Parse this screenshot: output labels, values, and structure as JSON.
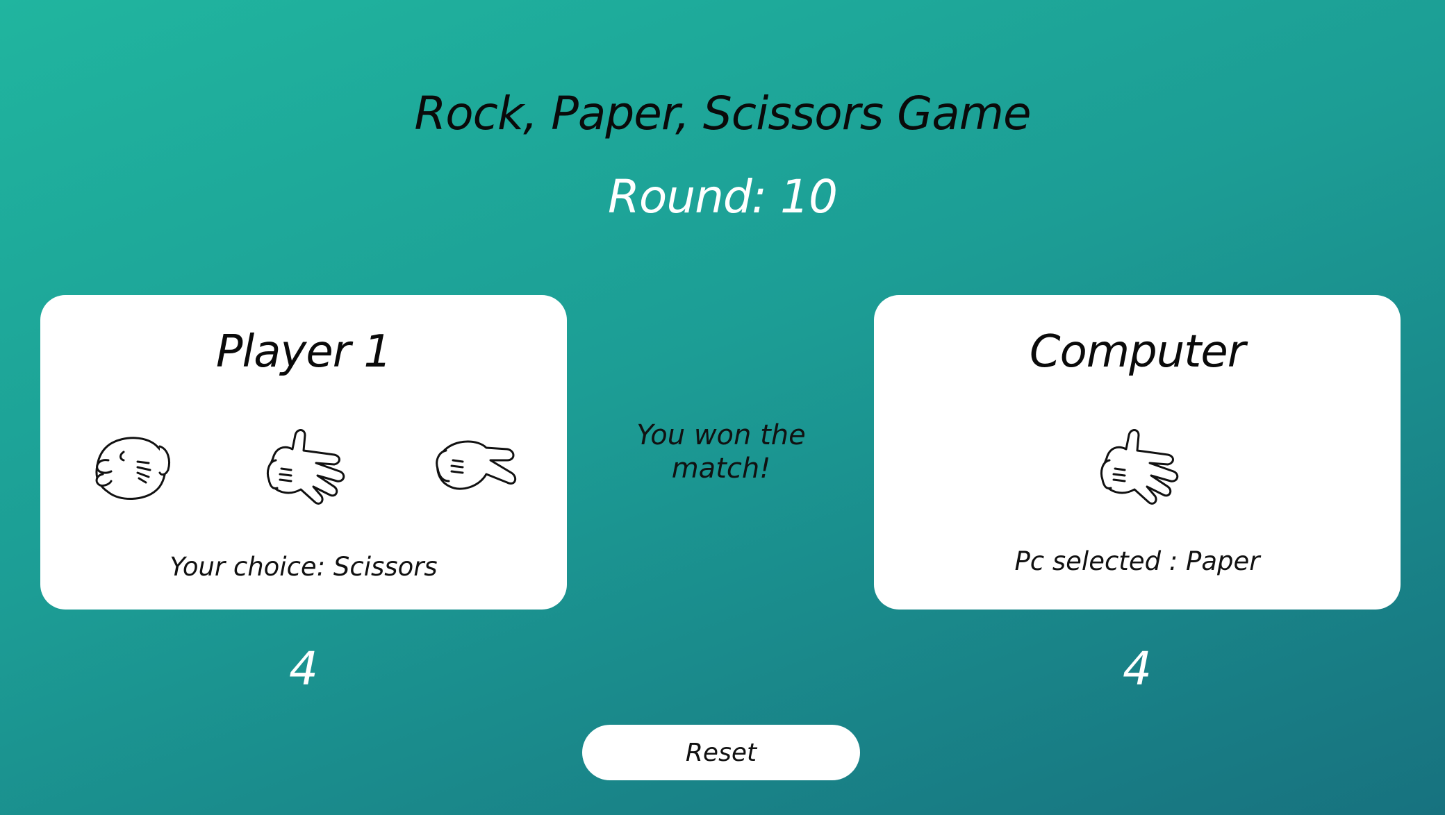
{
  "header": {
    "title": "Rock, Paper, Scissors Game",
    "round": "Round: 10"
  },
  "player": {
    "name": "Player 1",
    "choices": [
      {
        "label": "Rock",
        "icon": "rock-hand-icon"
      },
      {
        "label": "Paper",
        "icon": "paper-hand-icon"
      },
      {
        "label": "Scissors",
        "icon": "scissors-hand-icon"
      }
    ],
    "choice_text": "Your choice: Scissors",
    "score": "4"
  },
  "computer": {
    "name": "Computer",
    "selected_icon": "paper-hand-icon",
    "choice_text": "Pc selected : Paper",
    "score": "4"
  },
  "result": {
    "message": "You won the match!"
  },
  "controls": {
    "reset_label": "Reset"
  },
  "colors": {
    "background_start": "#20b59f",
    "background_end": "#17727f",
    "card": "#ffffff",
    "text_dark": "#0a0a0a",
    "text_light": "#ffffff"
  }
}
